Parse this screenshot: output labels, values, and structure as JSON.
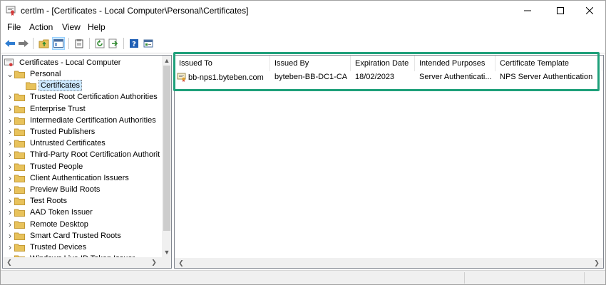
{
  "window": {
    "title": "certlm - [Certificates - Local Computer\\Personal\\Certificates]",
    "controls": {
      "minimize": "minimize",
      "maximize": "maximize",
      "close": "close"
    }
  },
  "menu": {
    "items": [
      "File",
      "Action",
      "View",
      "Help"
    ]
  },
  "toolbar": {
    "buttons": [
      "back-icon",
      "forward-icon",
      "up-folder-icon",
      "show-hide-tree-icon",
      "export-list-icon",
      "refresh-icon",
      "export-icon",
      "help-icon",
      "properties-icon"
    ]
  },
  "tree": {
    "root": "Certificates - Local Computer",
    "items": [
      {
        "label": "Personal",
        "expanded": true
      },
      {
        "label": "Certificates",
        "selected": true
      },
      {
        "label": "Trusted Root Certification Authorities"
      },
      {
        "label": "Enterprise Trust"
      },
      {
        "label": "Intermediate Certification Authorities"
      },
      {
        "label": "Trusted Publishers"
      },
      {
        "label": "Untrusted Certificates"
      },
      {
        "label": "Third-Party Root Certification Authorit"
      },
      {
        "label": "Trusted People"
      },
      {
        "label": "Client Authentication Issuers"
      },
      {
        "label": "Preview Build Roots"
      },
      {
        "label": "Test Roots"
      },
      {
        "label": "AAD Token Issuer"
      },
      {
        "label": "Remote Desktop"
      },
      {
        "label": "Smart Card Trusted Roots"
      },
      {
        "label": "Trusted Devices"
      },
      {
        "label": "Windows Live ID Token Issuer"
      }
    ]
  },
  "list": {
    "columns": [
      "Issued To",
      "Issued By",
      "Expiration Date",
      "Intended Purposes",
      "Certificate Template"
    ],
    "rows": [
      {
        "issued_to": "bb-nps1.byteben.com",
        "issued_by": "byteben-BB-DC1-CA",
        "expiration": "18/02/2023",
        "purposes": "Server Authenticati...",
        "template": "NPS Server Authentication"
      }
    ]
  },
  "colors": {
    "highlight": "#1ea07a",
    "selection": "#cce8ff",
    "folder": "#e8c25b"
  }
}
